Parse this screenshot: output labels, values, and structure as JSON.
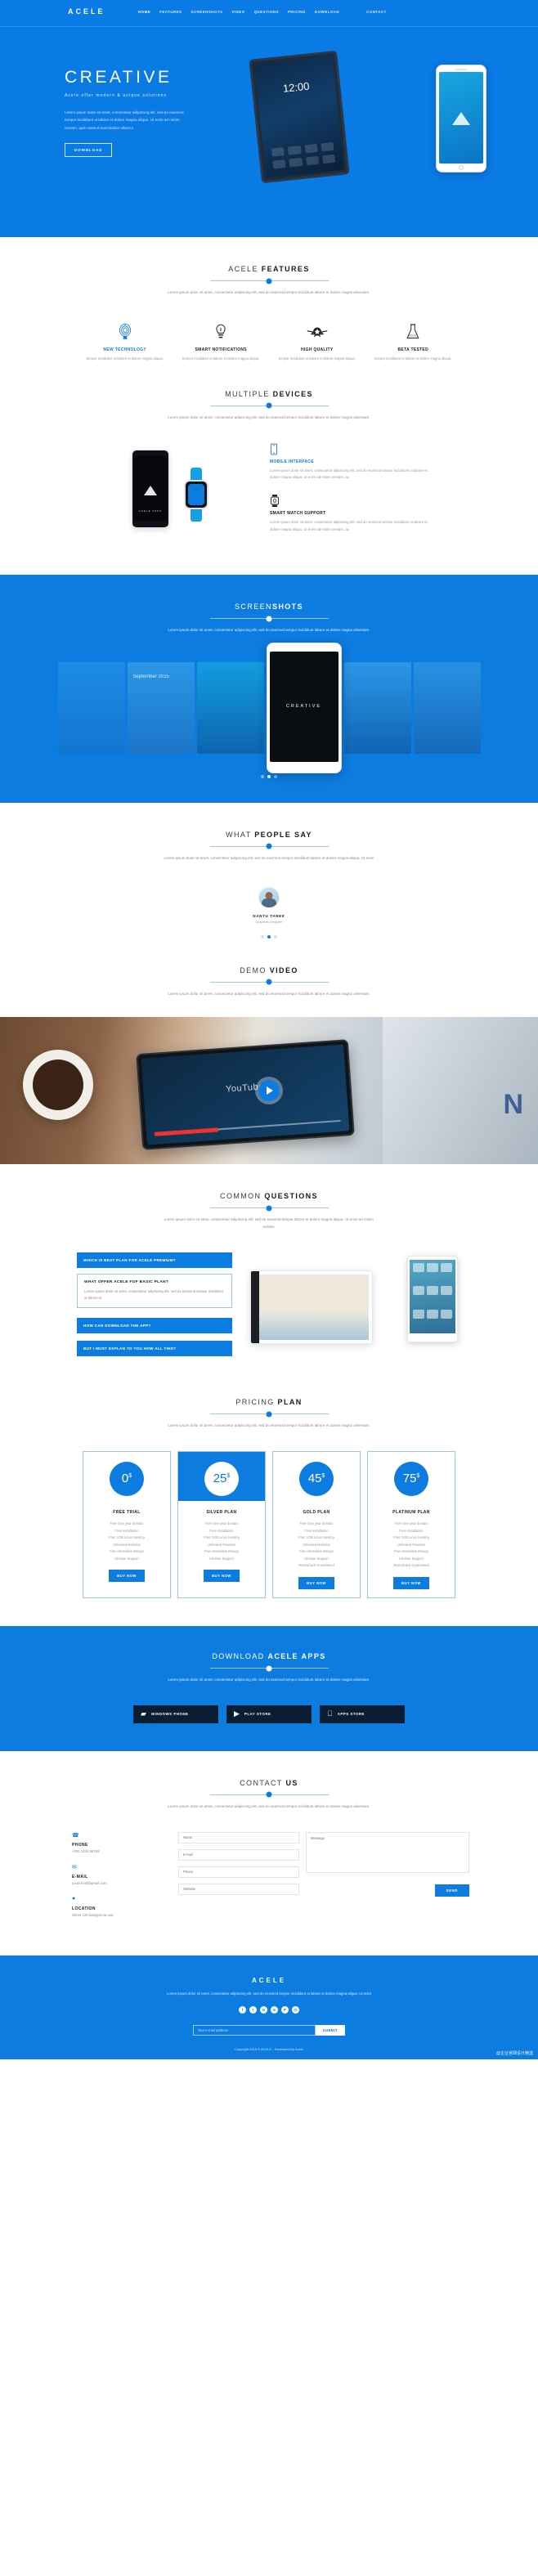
{
  "brand": "ACELE",
  "accent": "#0d7ce0",
  "nav": {
    "items": [
      {
        "label": "HOME",
        "active": true
      },
      {
        "label": "FEATURES",
        "active": false
      },
      {
        "label": "SCREENSHOTS",
        "active": false
      },
      {
        "label": "VIDEO",
        "active": false
      },
      {
        "label": "QUESTIONS",
        "active": false
      },
      {
        "label": "PRICING",
        "active": false
      },
      {
        "label": "DOWNLOAD",
        "active": false
      },
      {
        "label": "CONTACT",
        "active": false
      }
    ]
  },
  "hero": {
    "title": "CREATIVE",
    "subtitle": "Acele offer modern & unique solutions",
    "paragraph": "Lorem ipsum dolor sit amet, consectetur adipiscing elit, sed do eiusmod tempor incididunt ut labore et dolore magna aliqua. Ut enim ad minim veniam, quis nostrud exercitation ullamco",
    "button": "DOWNLOAD",
    "tablet_time": "12:00"
  },
  "features": {
    "title_light": "ACELE ",
    "title_bold": "FEATURES",
    "description": "Lorem ipsum dolor sit amet, consectetur adipiscing elit, sed do eiusmod tempor incididunt labore et dolore magna aliveniam.",
    "items": [
      {
        "icon": "fingerprint-icon",
        "name": "NEW TECHNOLOGY",
        "text": "tempor incididunt ut labore et dolore magna aliqua.",
        "highlight": true
      },
      {
        "icon": "lightbulb-icon",
        "name": "SMART NOTIFICATIONS",
        "text": "tempor incididunt ut labore et dolore magna aliqua.",
        "highlight": false
      },
      {
        "icon": "badge-wings-icon",
        "name": "HIGH QUALITY",
        "text": "tempor incididunt ut labore et dolore magna aliqua.",
        "highlight": false
      },
      {
        "icon": "flask-icon",
        "name": "BETA TESTED",
        "text": "tempor incididunt ut labore et dolore magna aliqua.",
        "highlight": false
      }
    ]
  },
  "devices": {
    "title_light": "MULTIPLE ",
    "title_bold": "DEVICES",
    "description": "Lorem ipsum dolor sit amet, consectetur adipiscing elit, sed do eiusmod tempor incididunt labore et dolore magna aliveniam.",
    "phone_label": "ACELE APPS",
    "items": [
      {
        "icon": "mobile-icon",
        "name": "MOBILE INTERFACE",
        "text": "Lorem ipsum dolor sit amet, consectetur adipiscing elit, sed do eiusmod tempor incididunt ut labore et dolore magna aliqua. Ut enim ad minim veniam, qu",
        "highlight": true
      },
      {
        "icon": "smartwatch-icon",
        "name": "SMART WATCH SUPPORT",
        "text": "Lorem ipsum dolor sit amet, consectetur adipiscing elit, sed do eiusmod tempor incididunt ut labore et dolore magna aliqua. Ut enim ad minim veniam, qu",
        "highlight": false
      }
    ]
  },
  "screenshots": {
    "title_light": "SCREEN",
    "title_bold": "SHOTS",
    "description": "Lorem ipsum dolor sit amet, consectetur adipiscing elit, sed do eiusmod tempor incididunt labore et dolore magna aliveniam.",
    "center_label": "CREATIVE",
    "slide_left_title": "September 2015",
    "dots": [
      false,
      true,
      false
    ]
  },
  "testimonials": {
    "title_light": "WHAT ",
    "title_bold": "PEOPLE SAY",
    "description": "Lorem ipsum dolor sit amet, consectetur adipiscing elit, sed do eiusmod tempor incididunt labore et dolore magna aliqua. Ut enim",
    "person_name": "NANTU TAREK",
    "person_role": "Graphics Designer",
    "dots": [
      false,
      true,
      false
    ]
  },
  "video": {
    "title_light": "DEMO ",
    "title_bold": "VIDEO",
    "description": "Lorem ipsum dolor sit amet, consectetur adipiscing elit, sed do eiusmod tempor incididunt labore et dolore magna aliveniam.",
    "overlay_text": "YouTube",
    "play_label": "play-video"
  },
  "questions": {
    "title_light": "COMMON ",
    "title_bold": "QUESTIONS",
    "description": "Lorem ipsum dolor sit amet, consectetur adipiscing elit, sed do eiusmod tempor labore et dolore magna aliqua. Ut enim ad minim veniam.",
    "items": [
      {
        "q": "WHICH IS BEST PLAN FOR ACELE PREMIUM?",
        "open": false,
        "a": ""
      },
      {
        "q": "WHAT OFFER ACELE FOF BASIC PLAN?",
        "open": true,
        "a": "Lorem ipsum dolor sit amet, consectetur adipiscing elit, sed do eiusmod tempor incididunt ut labore et"
      },
      {
        "q": "HOW CAN DOWNLOAD THE APP?",
        "open": false,
        "a": ""
      },
      {
        "q": "BUT I MUST EXPLAN TO YOU HOW ALL THIS?",
        "open": false,
        "a": ""
      }
    ]
  },
  "pricing": {
    "title_light": "PRICING ",
    "title_bold": "PLAN",
    "description": "Lorem ipsum dolor sit amet, consectetur adipiscing elit, sed do eiusmod tempor incididunt labore et dolore magna aliveniam.",
    "plans": [
      {
        "price": "0",
        "currency": "$",
        "name": "FREE TRIAL",
        "featured": false,
        "features": [
          "Free One year domain",
          "Free Installation",
          "Free 1GB Linux Hosting",
          "Unlimited Revision",
          "Five Alternative Design",
          "Lifetime Support"
        ],
        "button": "BUY NOW"
      },
      {
        "price": "25",
        "currency": "$",
        "name": "SILVER PLAN",
        "featured": true,
        "features": [
          "Free One year domain",
          "Free Installation",
          "Free 1GB Linux Hosting",
          "Unlimited Revision",
          "Five Alternative Design",
          "Lifetime Support"
        ],
        "button": "BUY NOW"
      },
      {
        "price": "45",
        "currency": "$",
        "name": "GOLD PLAN",
        "featured": false,
        "features": [
          "Free One year domain",
          "Free Installation",
          "Free 1GB Linux Hosting",
          "Unlimited Revision",
          "Five Alternative Design",
          "Lifetime Support",
          "Moneyback Guaranteed"
        ],
        "button": "BUY NOW"
      },
      {
        "price": "75",
        "currency": "$",
        "name": "PLATINUM PLAN",
        "featured": false,
        "features": [
          "Free One year domain",
          "Free Installation",
          "Free 1GB Linux Hosting",
          "Unlimited Revision",
          "Five Alternative Design",
          "Lifetime Support",
          "Moneyback Guaranteed"
        ],
        "button": "BUY NOW"
      }
    ]
  },
  "download": {
    "title_light": "DOWNLOAD ",
    "title_bold": "ACELE APPS",
    "description": "Lorem ipsum dolor sit amet, consectetur adipiscing elit, sed do eiusmod tempor incididunt labore et dolore magna aliveniam.",
    "stores": [
      {
        "icon": "windows-icon",
        "label": "WINDOWS PHONE"
      },
      {
        "icon": "play-store-icon",
        "label": "PLAY STORE"
      },
      {
        "icon": "apple-icon",
        "label": "APPS STORE"
      }
    ]
  },
  "contact": {
    "title_light": "CONTACT ",
    "title_bold": "US",
    "description": "Lorem ipsum dolor sit amet, consectetur adipiscing elit, sed do eiusmod tempor incididunt labore et dolore magna aliveniam.",
    "info": [
      {
        "icon": "phone-icon",
        "label": "PHONE",
        "value": "+000 1234 56789"
      },
      {
        "icon": "envelope-icon",
        "label": "E-MAIL",
        "value": "youremail@gmail.com"
      },
      {
        "icon": "location-pin-icon",
        "label": "LOCATION",
        "value": "Street 120  katagonma usa"
      }
    ],
    "fields": [
      {
        "name": "name-field",
        "placeholder": "Name"
      },
      {
        "name": "email-field",
        "placeholder": "E-mail"
      },
      {
        "name": "phone-field",
        "placeholder": "Phone"
      },
      {
        "name": "website-field",
        "placeholder": "Website"
      }
    ],
    "message_placeholder": "Message",
    "send_label": "SEND"
  },
  "footer": {
    "logo": "ACELE",
    "text": "Lorem ipsum dolor sit amet, consectetur adipiscing elit, sed do eiusmod tempor incididunt ut labore et dolore magna aliqua. Ut enim",
    "socials": [
      "f",
      "t",
      "G",
      "in",
      "P",
      "@"
    ],
    "subscribe_placeholder": "Your e-mail address",
    "subscribe_button": "SUBMIT",
    "copyright": "Copyright 2015 © ACELE  -  Developed by Acele",
    "watermark": "@企业官网设计精选"
  }
}
